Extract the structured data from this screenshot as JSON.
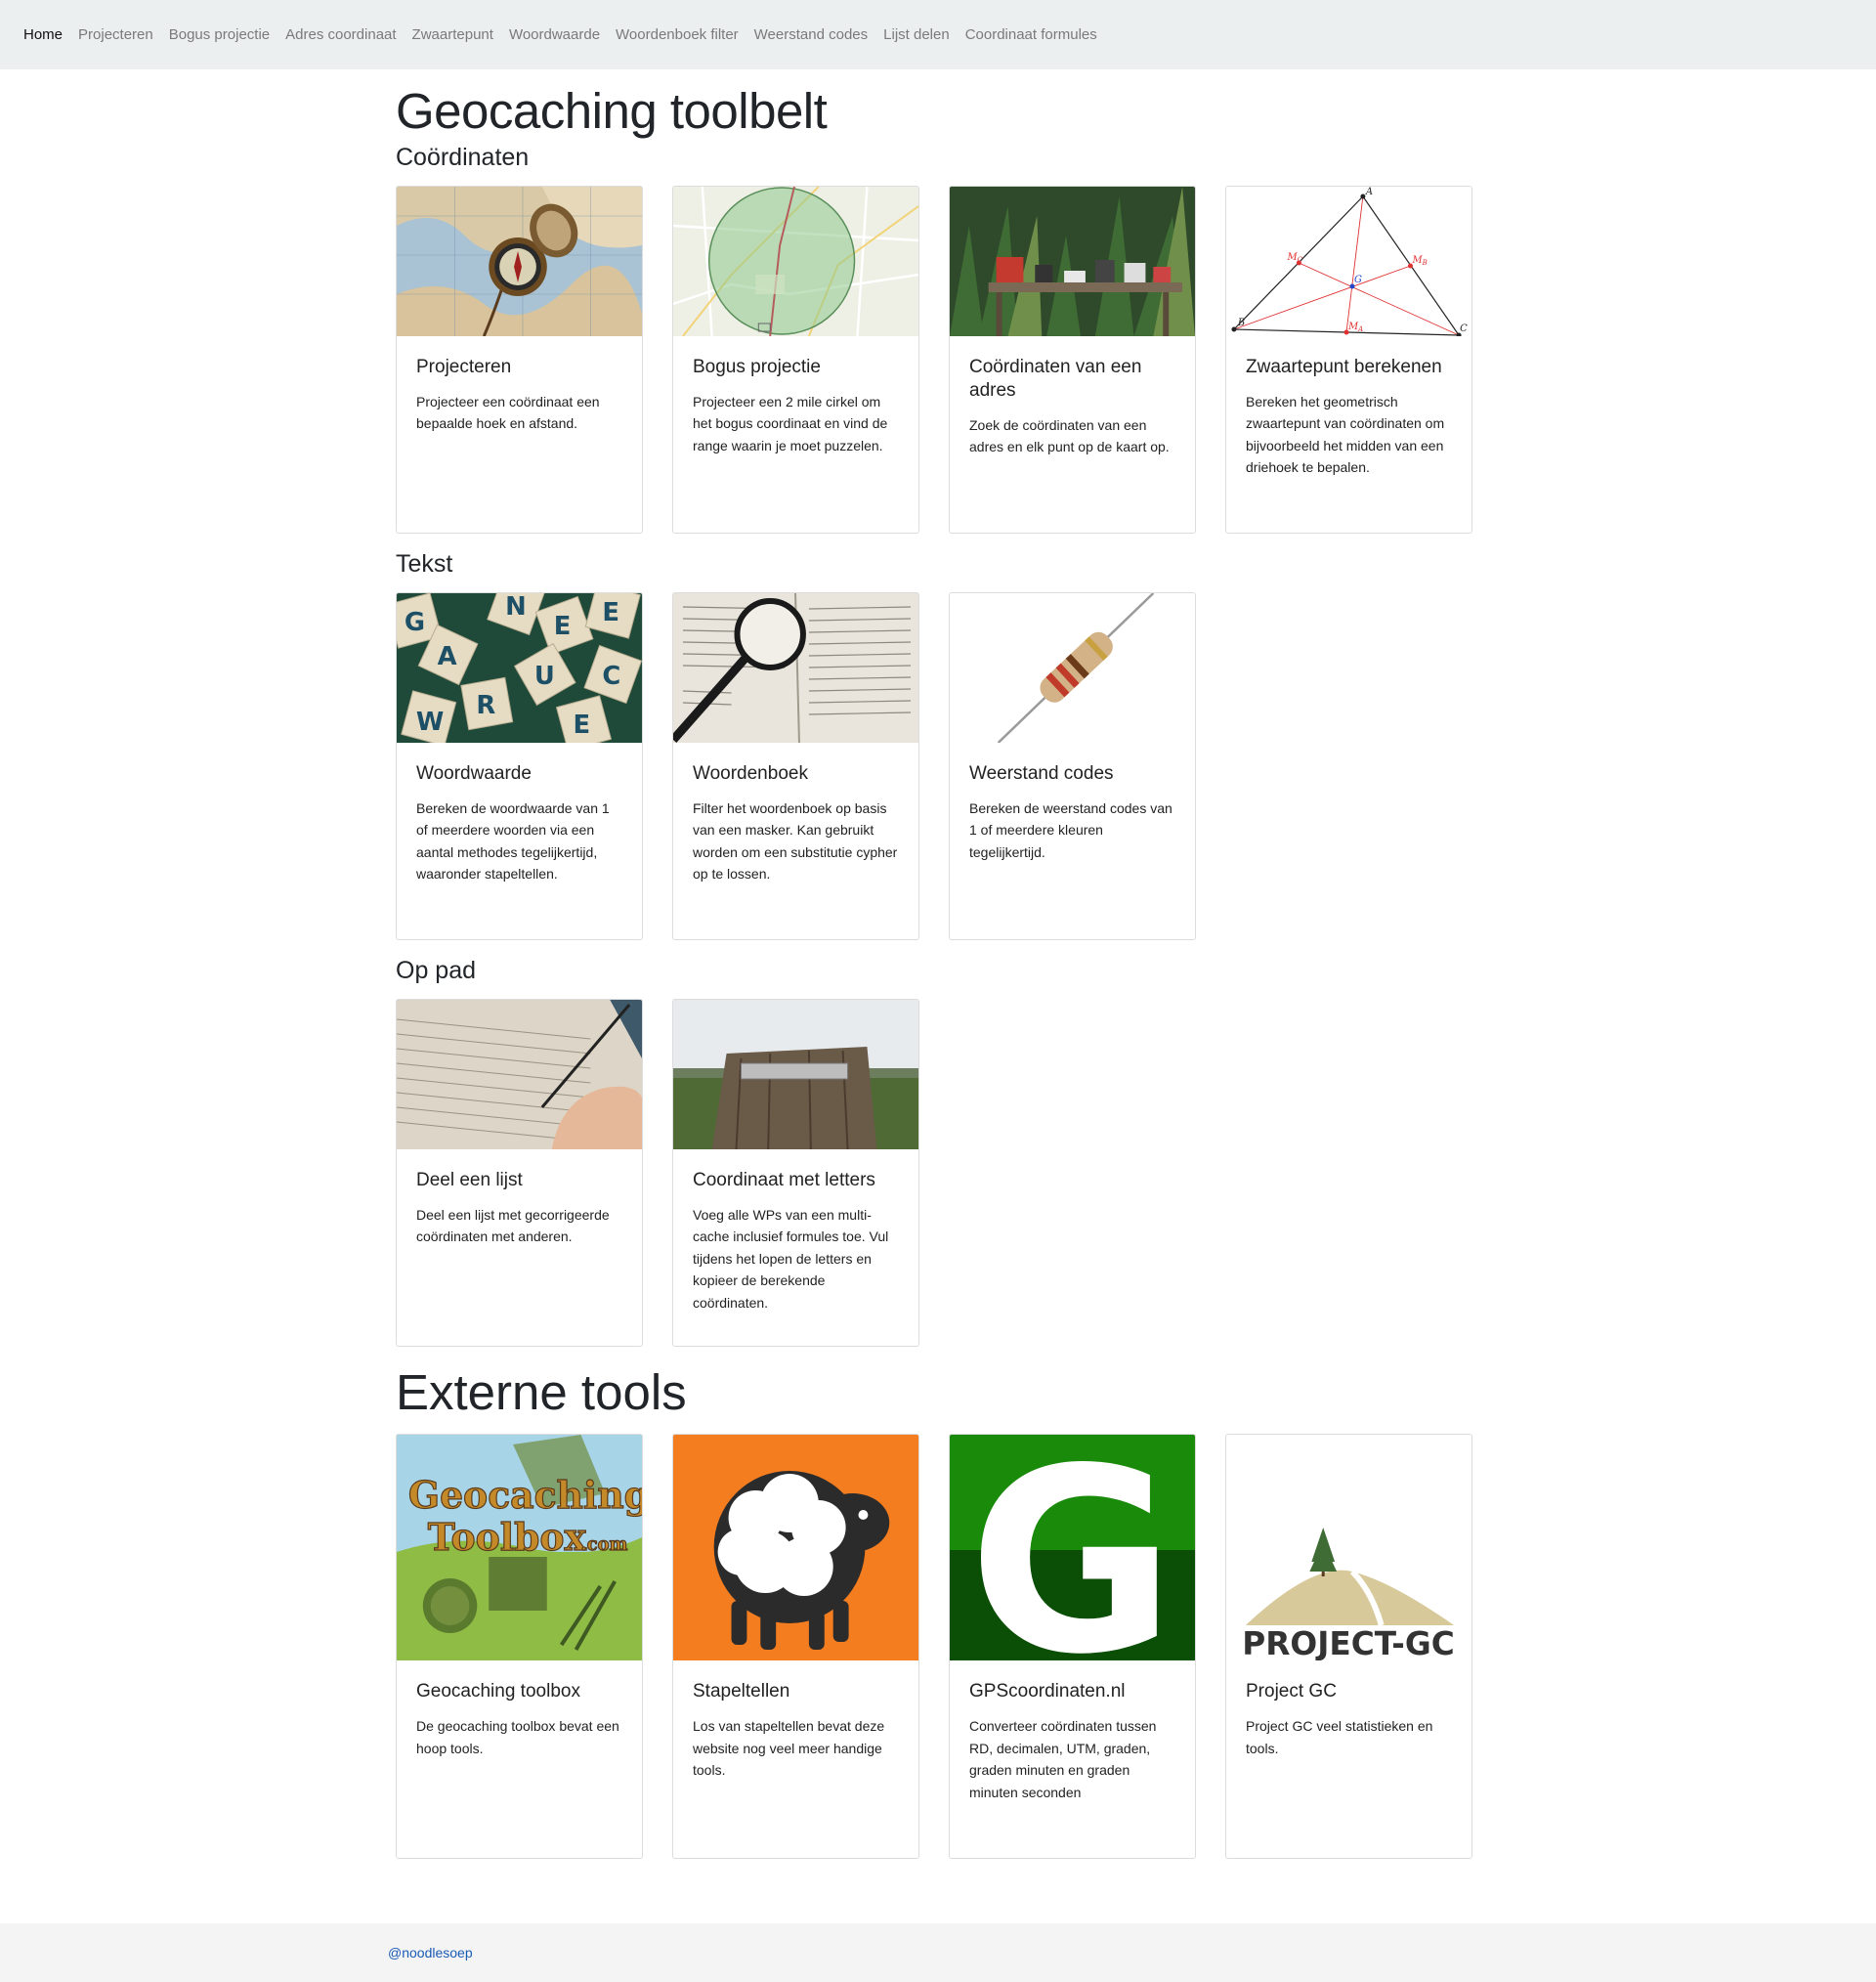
{
  "nav": {
    "items": [
      "Home",
      "Projecteren",
      "Bogus projectie",
      "Adres coordinaat",
      "Zwaartepunt",
      "Woordwaarde",
      "Woordenboek filter",
      "Weerstand codes",
      "Lijst delen",
      "Coordinaat formules"
    ],
    "active": "Home"
  },
  "page_title": "Geocaching toolbelt",
  "sections": {
    "coordinates": {
      "title": "Coördinaten",
      "cards": [
        {
          "title": "Projecteren",
          "text": "Projecteer een coördinaat een bepaalde hoek en afstand.",
          "image": "compass-on-map"
        },
        {
          "title": "Bogus projectie",
          "text": "Projecteer een 2 mile cirkel om het bogus coordinaat en vind de range waarin je moet puzzelen.",
          "image": "map-circle"
        },
        {
          "title": "Coördinaten van een adres",
          "text": "Zoek de coördinaten van een adres en elk punt op de kaart op.",
          "image": "mailboxes"
        },
        {
          "title": "Zwaartepunt berekenen",
          "text": "Bereken het geometrisch zwaartepunt van coördinaten om bijvoorbeeld het midden van een driehoek te bepalen.",
          "image": "triangle-centroid",
          "labels": [
            "A",
            "B",
            "C",
            "G",
            "MA",
            "MB",
            "MC"
          ]
        }
      ]
    },
    "text": {
      "title": "Tekst",
      "cards": [
        {
          "title": "Woordwaarde",
          "text": "Bereken de woordwaarde van 1 of meerdere woorden via een aantal methodes tegelijkertijd, waaronder stapeltellen.",
          "image": "letter-tiles",
          "tiles": [
            "G",
            "N",
            "E",
            "E",
            "A",
            "U",
            "R",
            "C",
            "W",
            "E"
          ]
        },
        {
          "title": "Woordenboek",
          "text": "Filter het woordenboek op basis van een masker. Kan gebruikt worden om een substitutie cypher op te lossen.",
          "image": "magnifier-dictionary"
        },
        {
          "title": "Weerstand codes",
          "text": "Bereken de weerstand codes van 1 of meerdere kleuren tegelijkertijd.",
          "image": "resistor"
        }
      ]
    },
    "on_the_road": {
      "title": "Op pad",
      "cards": [
        {
          "title": "Deel een lijst",
          "text": "Deel een lijst met gecorrigeerde coördinaten met anderen.",
          "image": "checklist"
        },
        {
          "title": "Coordinaat met letters",
          "text": "Voeg alle WPs van een multi-cache inclusief formules toe. Vul tijdens het lopen de letters en kopieer de berekende coördinaten.",
          "image": "waypoint-post"
        }
      ]
    },
    "external": {
      "title": "Externe tools",
      "cards": [
        {
          "title": "Geocaching toolbox",
          "text": "De geocaching toolbox bevat een hoop tools.",
          "image": "geocaching-toolbox-logo",
          "logo_lines": [
            "Geocaching",
            "Toolbox",
            ".com"
          ]
        },
        {
          "title": "Stapeltellen",
          "text": "Los van stapeltellen bevat deze website nog veel meer handige tools.",
          "image": "sheep-logo"
        },
        {
          "title": "GPScoordinaten.nl",
          "text": "Converteer coördinaten tussen RD, decimalen, UTM, graden, graden minuten en graden minuten seconden",
          "image": "g-logo",
          "logo_letter": "G"
        },
        {
          "title": "Project GC",
          "text": "Project GC veel statistieken en tools.",
          "image": "project-gc-logo",
          "logo_text": "PROJECT-GC"
        }
      ]
    }
  },
  "footer": {
    "link": "@noodlesoep"
  },
  "colors": {
    "navbar_bg": "#eceff0",
    "footer_bg": "#f4f4f4",
    "link": "#1a5bb5",
    "card_border": "#dcdcdc"
  }
}
